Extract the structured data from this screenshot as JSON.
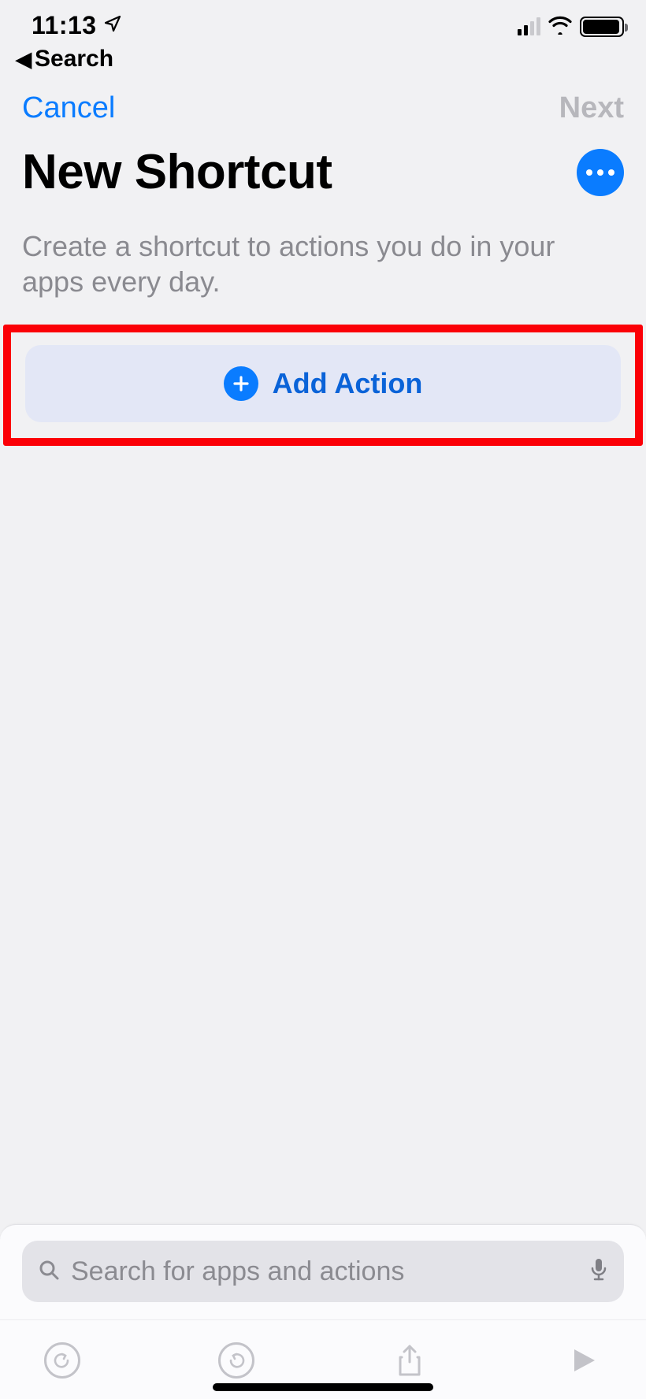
{
  "status": {
    "time": "11:13",
    "back_label": "Search"
  },
  "nav": {
    "cancel": "Cancel",
    "next": "Next"
  },
  "header": {
    "title": "New Shortcut"
  },
  "description": "Create a shortcut to actions you do in your apps every day.",
  "add_action": {
    "label": "Add Action"
  },
  "search": {
    "placeholder": "Search for apps and actions"
  }
}
